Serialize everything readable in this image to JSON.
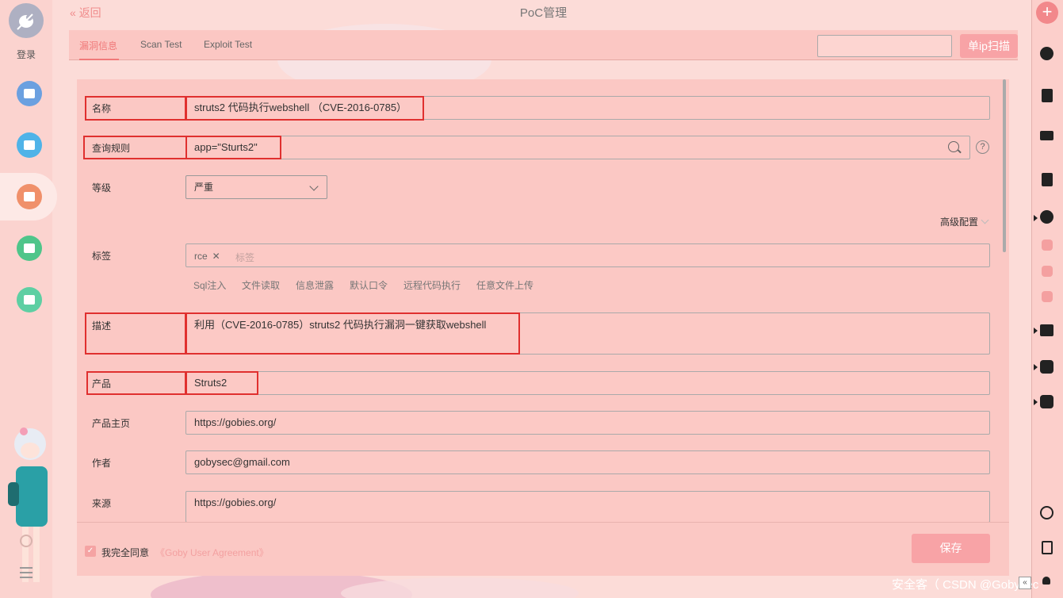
{
  "sidebar": {
    "login_label": "登录",
    "nav_colors": [
      "#6ba0e0",
      "#4fb3e8",
      "#f0906a",
      "#4fc58a",
      "#5ecfa3"
    ]
  },
  "header": {
    "back_label": "返回",
    "back_icon": "double-chevron-left-icon",
    "title": "PoC管理"
  },
  "tabs": [
    {
      "label": "漏洞信息",
      "active": true
    },
    {
      "label": "Scan Test",
      "active": false
    },
    {
      "label": "Exploit Test",
      "active": false
    }
  ],
  "scan": {
    "input_value": "",
    "button_label": "单ip扫描"
  },
  "form": {
    "name_label": "名称",
    "name_value": "struts2 代码执行webshell （CVE-2016-0785）",
    "query_label": "查询规则",
    "query_value": "app=\"Sturts2\"",
    "level_label": "等级",
    "level_value": "严重",
    "advanced_label": "高级配置",
    "tags_label": "标签",
    "tags": [
      "rce"
    ],
    "tag_placeholder": "标签",
    "tag_suggestions": [
      "Sql注入",
      "文件读取",
      "信息泄露",
      "默认口令",
      "远程代码执行",
      "任意文件上传"
    ],
    "desc_label": "描述",
    "desc_value": "利用（CVE-2016-0785）struts2 代码执行漏洞一键获取webshell",
    "product_label": "产品",
    "product_value": "Struts2",
    "homepage_label": "产品主页",
    "homepage_value": "https://gobies.org/",
    "author_label": "作者",
    "author_value": "gobysec@gmail.com",
    "source_label": "来源",
    "source_value": "https://gobies.org/"
  },
  "footer": {
    "agree_checked": true,
    "agree_label": "我完全同意",
    "agree_link": "《Goby User Agreement》",
    "save_label": "保存"
  },
  "toolbar": {
    "add_label": "+",
    "icons": [
      "clock-icon",
      "save-icon",
      "monitor-icon",
      "ip-icon",
      "bug-icon",
      "plugin-icon",
      "plugin-icon",
      "plugin-icon",
      "chart-icon",
      "puzzle-icon",
      "puzzle-settings-icon",
      "refresh-icon",
      "report-icon",
      "bell-icon"
    ]
  },
  "watermark": "安全客（ CSDN @Gobysec",
  "accent_color": "#f07979"
}
